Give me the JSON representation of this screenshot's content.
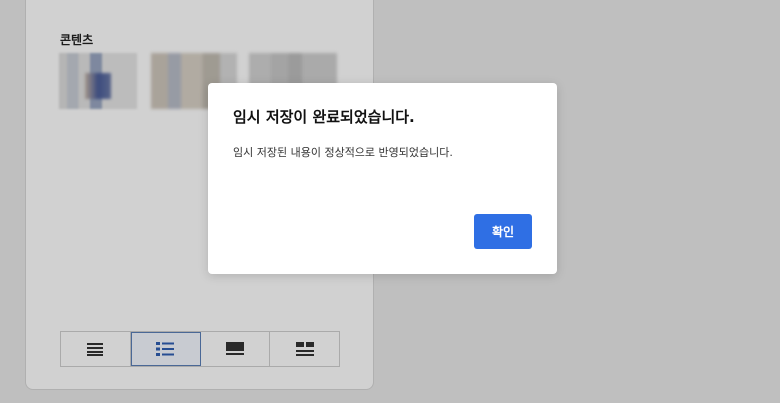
{
  "panel": {
    "content_label": "콘텐츠",
    "view_modes": [
      {
        "name": "list-compact",
        "icon": "list-lines-icon",
        "active": false
      },
      {
        "name": "list-detail",
        "icon": "list-bullets-icon",
        "active": true
      },
      {
        "name": "card",
        "icon": "card-view-icon",
        "active": false
      },
      {
        "name": "grid",
        "icon": "grid-view-icon",
        "active": false
      }
    ]
  },
  "dialog": {
    "title": "임시 저장이 완료되었습니다.",
    "message": "임시 저장된 내용이 정상적으로 반영되었습니다.",
    "confirm_label": "확인"
  },
  "colors": {
    "primary": "#2f6fe4",
    "overlay": "rgba(0,0,0,0.18)",
    "active_outline": "#5b7fb7"
  }
}
